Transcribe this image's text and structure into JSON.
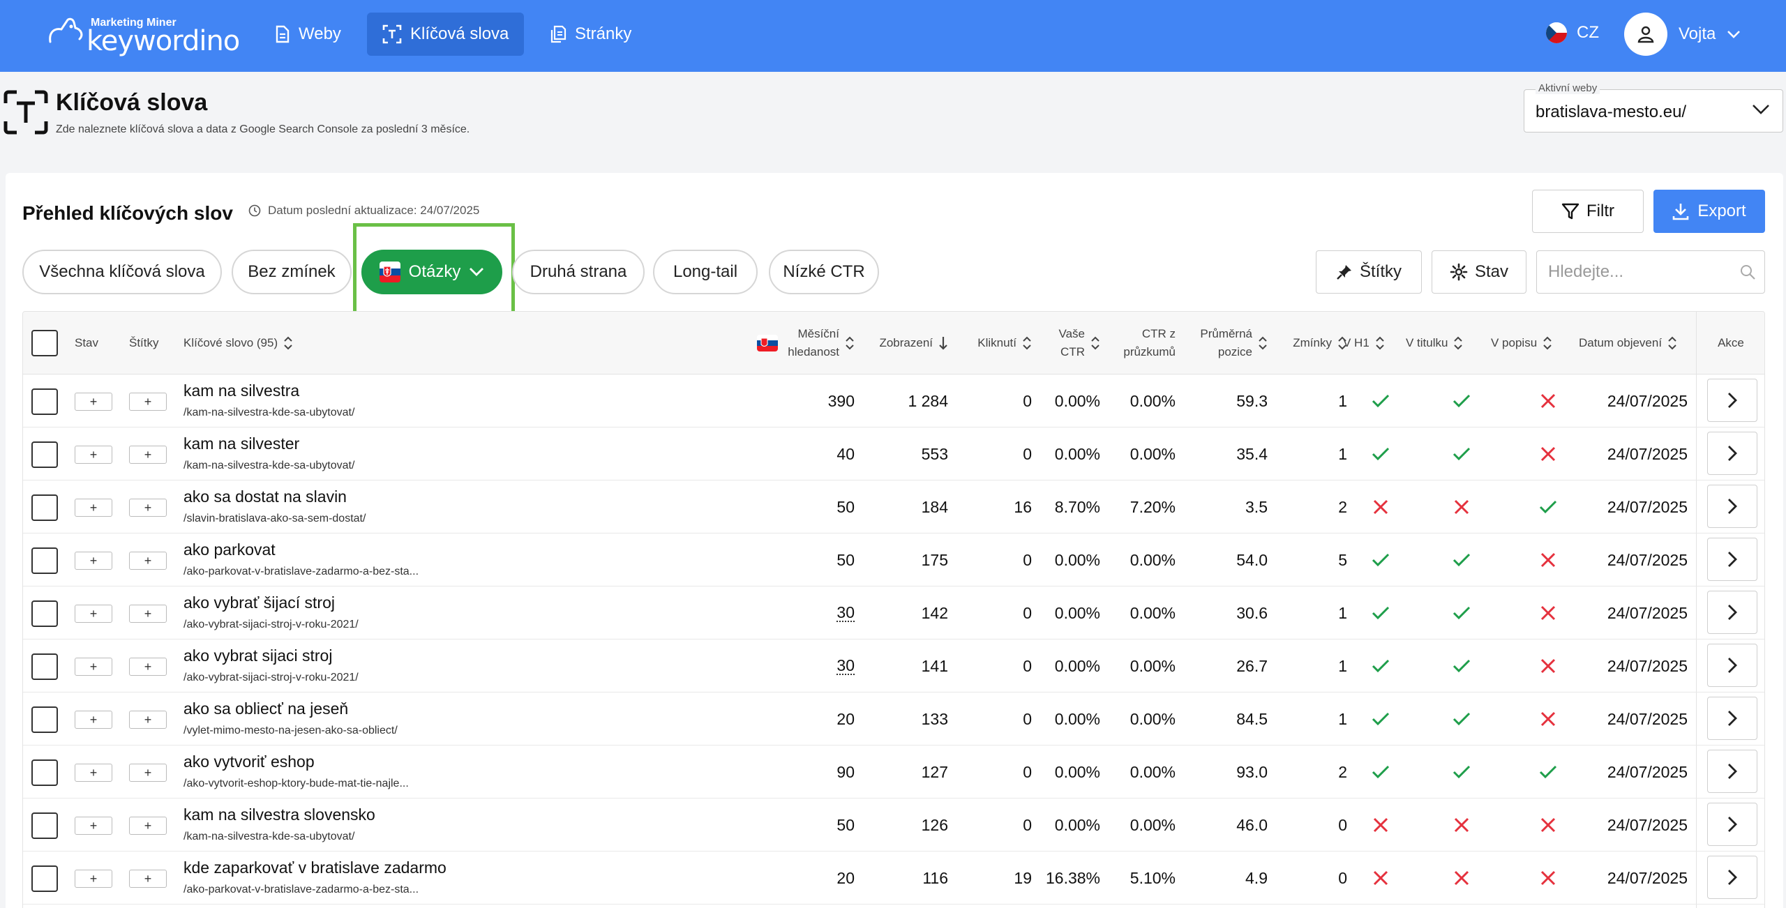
{
  "nav": {
    "logo_top": "Marketing Miner",
    "logo_main": "keywordino",
    "items": [
      {
        "label": "Weby",
        "icon": "document-icon"
      },
      {
        "label": "Klíčová slova",
        "icon": "keyword-icon"
      },
      {
        "label": "Stránky",
        "icon": "pages-icon"
      }
    ],
    "language": "CZ",
    "user": "Vojta"
  },
  "header": {
    "title": "Klíčová slova",
    "subtitle": "Zde naleznete klíčová slova a data z Google Search Console za poslední 3 měsíce.",
    "site_select_label": "Aktivní weby",
    "site_select_value": "bratislava-mesto.eu/"
  },
  "overview": {
    "title": "Přehled klíčových slov",
    "updated": "Datum poslední aktualizace: 24/07/2025",
    "filter_label": "Filtr",
    "export_label": "Export",
    "pills": [
      "Všechna klíčová slova",
      "Bez zmínek",
      "Otázky",
      "Druhá strana",
      "Long-tail",
      "Nízké CTR"
    ],
    "active_pill": "Otázky",
    "tags_label": "Štítky",
    "state_label": "Stav",
    "search_placeholder": "Hledejte..."
  },
  "table": {
    "headers": {
      "state": "Stav",
      "tags": "Štítky",
      "keyword": "Klíčové slovo (95)",
      "monthly_1": "Měsíční",
      "monthly_2": "hledanost",
      "impressions": "Zobrazení",
      "clicks": "Kliknutí",
      "ctr_1": "Vaše",
      "ctr_2": "CTR",
      "survey_ctr_1": "CTR z",
      "survey_ctr_2": "průzkumů",
      "position_1": "Průměrná",
      "position_2": "pozice",
      "mentions": "Zmínky",
      "h1": "V H1",
      "title": "V titulku",
      "description": "V popisu",
      "discovered": "Datum objevení",
      "action": "Akce"
    },
    "plus_label": "+",
    "rows": [
      {
        "kw": "kam na silvestra",
        "url": "/kam-na-silvestra-kde-sa-ubytovat/",
        "monthly": "390",
        "dotted": false,
        "impr": "1 284",
        "clicks": "0",
        "ctr": "0.00%",
        "sctr": "0.00%",
        "pos": "59.3",
        "mentions": "1",
        "h1": true,
        "title": true,
        "desc": false,
        "date": "24/07/2025"
      },
      {
        "kw": "kam na silvester",
        "url": "/kam-na-silvestra-kde-sa-ubytovat/",
        "monthly": "40",
        "dotted": false,
        "impr": "553",
        "clicks": "0",
        "ctr": "0.00%",
        "sctr": "0.00%",
        "pos": "35.4",
        "mentions": "1",
        "h1": true,
        "title": true,
        "desc": false,
        "date": "24/07/2025"
      },
      {
        "kw": "ako sa dostat na slavin",
        "url": "/slavin-bratislava-ako-sa-sem-dostat/",
        "monthly": "50",
        "dotted": false,
        "impr": "184",
        "clicks": "16",
        "ctr": "8.70%",
        "sctr": "7.20%",
        "pos": "3.5",
        "mentions": "2",
        "h1": false,
        "title": false,
        "desc": true,
        "date": "24/07/2025"
      },
      {
        "kw": "ako parkovat",
        "url": "/ako-parkovat-v-bratislave-zadarmo-a-bez-sta...",
        "monthly": "50",
        "dotted": false,
        "impr": "175",
        "clicks": "0",
        "ctr": "0.00%",
        "sctr": "0.00%",
        "pos": "54.0",
        "mentions": "5",
        "h1": true,
        "title": true,
        "desc": false,
        "date": "24/07/2025"
      },
      {
        "kw": "ako vybrať šijací stroj",
        "url": "/ako-vybrat-sijaci-stroj-v-roku-2021/",
        "monthly": "30",
        "dotted": true,
        "impr": "142",
        "clicks": "0",
        "ctr": "0.00%",
        "sctr": "0.00%",
        "pos": "30.6",
        "mentions": "1",
        "h1": true,
        "title": true,
        "desc": false,
        "date": "24/07/2025"
      },
      {
        "kw": "ako vybrat sijaci stroj",
        "url": "/ako-vybrat-sijaci-stroj-v-roku-2021/",
        "monthly": "30",
        "dotted": true,
        "impr": "141",
        "clicks": "0",
        "ctr": "0.00%",
        "sctr": "0.00%",
        "pos": "26.7",
        "mentions": "1",
        "h1": true,
        "title": true,
        "desc": false,
        "date": "24/07/2025"
      },
      {
        "kw": "ako sa obliecť na jeseň",
        "url": "/vylet-mimo-mesto-na-jesen-ako-sa-obliect/",
        "monthly": "20",
        "dotted": false,
        "impr": "133",
        "clicks": "0",
        "ctr": "0.00%",
        "sctr": "0.00%",
        "pos": "84.5",
        "mentions": "1",
        "h1": true,
        "title": true,
        "desc": false,
        "date": "24/07/2025"
      },
      {
        "kw": "ako vytvoriť eshop",
        "url": "/ako-vytvorit-eshop-ktory-bude-mat-tie-najle...",
        "monthly": "90",
        "dotted": false,
        "impr": "127",
        "clicks": "0",
        "ctr": "0.00%",
        "sctr": "0.00%",
        "pos": "93.0",
        "mentions": "2",
        "h1": true,
        "title": true,
        "desc": true,
        "date": "24/07/2025"
      },
      {
        "kw": "kam na silvestra slovensko",
        "url": "/kam-na-silvestra-kde-sa-ubytovat/",
        "monthly": "50",
        "dotted": false,
        "impr": "126",
        "clicks": "0",
        "ctr": "0.00%",
        "sctr": "0.00%",
        "pos": "46.0",
        "mentions": "0",
        "h1": false,
        "title": false,
        "desc": false,
        "date": "24/07/2025"
      },
      {
        "kw": "kde zaparkovať v bratislave zadarmo",
        "url": "/ako-parkovat-v-bratislave-zadarmo-a-bez-sta...",
        "monthly": "20",
        "dotted": false,
        "impr": "116",
        "clicks": "19",
        "ctr": "16.38%",
        "sctr": "5.10%",
        "pos": "4.9",
        "mentions": "0",
        "h1": false,
        "title": false,
        "desc": false,
        "date": "24/07/2025"
      }
    ]
  },
  "colors": {
    "primary": "#4285f4",
    "nav_active": "#2f6ed8",
    "green": "#1e9e4a",
    "highlight": "#6ac046",
    "check": "#1e9e4a",
    "cross": "#e5313d"
  }
}
